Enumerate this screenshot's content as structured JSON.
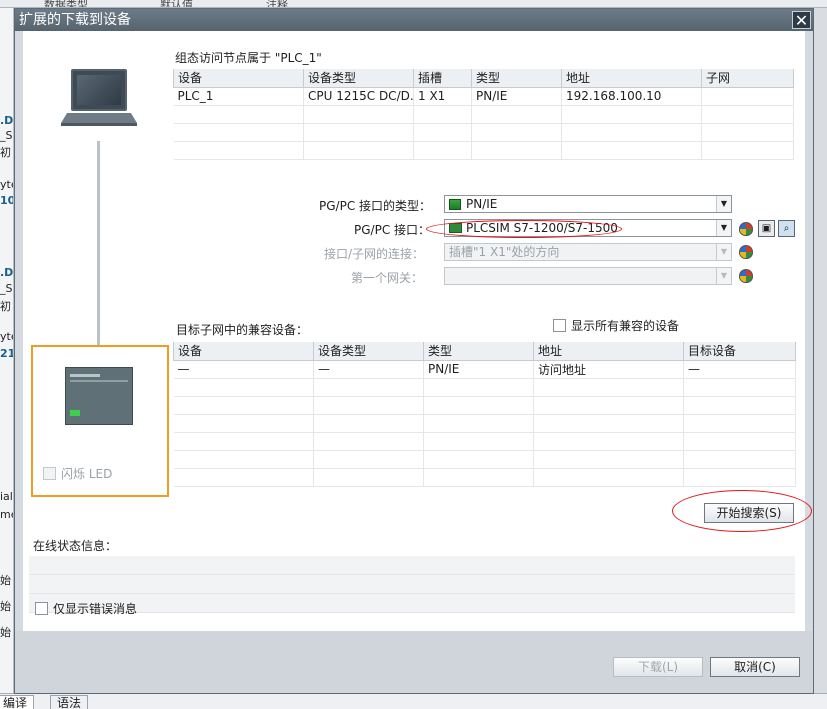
{
  "background": {
    "top_fragments": [
      "数据类型",
      "默认值",
      "注释"
    ],
    "left_fragments": [
      ".D",
      "_Sw",
      "初",
      "yte",
      "10",
      ".D",
      "_Sw",
      "初",
      "yte",
      "21",
      "ial",
      "me",
      "始",
      "始",
      "始"
    ],
    "bottom_tabs": [
      "编译",
      "语法"
    ]
  },
  "dialog": {
    "title": "扩展的下载到设备",
    "close_glyph": "✕",
    "config_header": "组态访问节点属于 \"PLC_1\"",
    "config_table": {
      "columns": [
        "设备",
        "设备类型",
        "插槽",
        "类型",
        "地址",
        "子网"
      ],
      "rows": [
        [
          "PLC_1",
          "CPU 1215C DC/D...",
          "1 X1",
          "PN/IE",
          "192.168.100.10",
          ""
        ]
      ]
    },
    "interface": {
      "type_label": "PG/PC 接口的类型：",
      "type_value": "PN/IE",
      "iface_label": "PG/PC 接口：",
      "iface_value": "PLCSIM S7-1200/S7-1500",
      "conn_label": "接口/子网的连接：",
      "conn_value": "插槽\"1 X1\"处的方向",
      "gateway_label": "第一个网关：",
      "gateway_value": ""
    },
    "compat_header": "目标子网中的兼容设备：",
    "show_all_label": "显示所有兼容的设备",
    "compat_table": {
      "columns": [
        "设备",
        "设备类型",
        "类型",
        "地址",
        "目标设备"
      ],
      "rows": [
        [
          "—",
          "—",
          "PN/IE",
          "访问地址",
          "—"
        ]
      ]
    },
    "flash_led_label": "闪烁 LED",
    "start_search_label": "开始搜索(S)",
    "online_status_label": "在线状态信息：",
    "errors_only_label": "仅显示错误消息",
    "download_label": "下载(L)",
    "cancel_label": "取消(C)"
  },
  "colors": {
    "accent_orange": "#f29b1f",
    "annotation_red": "#e2151b",
    "titlebar": "#5f6d79"
  }
}
